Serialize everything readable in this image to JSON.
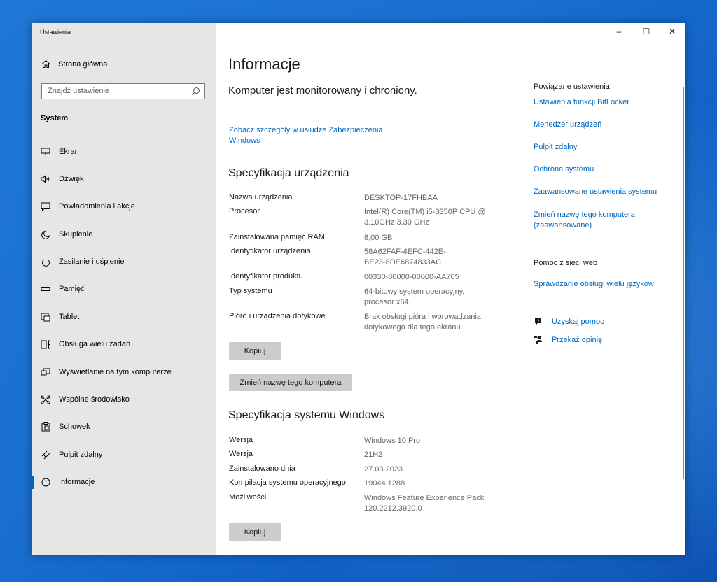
{
  "window": {
    "title": "Ustawienia",
    "controls": {
      "minimize": "–",
      "maximize": "☐",
      "close": "✕"
    }
  },
  "sidebar": {
    "home": "Strona główna",
    "search_placeholder": "Znajdź ustawienie",
    "section": "System",
    "items": [
      {
        "label": "Ekran",
        "icon": "monitor-icon"
      },
      {
        "label": "Dźwięk",
        "icon": "speaker-icon"
      },
      {
        "label": "Powiadomienia i akcje",
        "icon": "notification-icon"
      },
      {
        "label": "Skupienie",
        "icon": "moon-icon"
      },
      {
        "label": "Zasilanie i uśpienie",
        "icon": "power-icon"
      },
      {
        "label": "Pamięć",
        "icon": "storage-icon"
      },
      {
        "label": "Tablet",
        "icon": "tablet-icon"
      },
      {
        "label": "Obsługa wielu zadań",
        "icon": "multitasking-icon"
      },
      {
        "label": "Wyświetlanie na tym komputerze",
        "icon": "projecting-icon"
      },
      {
        "label": "Wspólne środowisko",
        "icon": "shared-icon"
      },
      {
        "label": "Schowek",
        "icon": "clipboard-icon"
      },
      {
        "label": "Pulpit zdalny",
        "icon": "remote-icon"
      },
      {
        "label": "Informacje",
        "icon": "info-icon",
        "active": true
      }
    ]
  },
  "main": {
    "title": "Informacje",
    "status": "Komputer jest monitorowany i chroniony.",
    "security_link": "Zobacz szczegóły w usłudze Zabezpieczenia Windows",
    "device_heading": "Specyfikacja urządzenia",
    "device_specs": [
      {
        "label": "Nazwa urządzenia",
        "value": "DESKTOP-17FHBAA"
      },
      {
        "label": "Procesor",
        "value": "Intel(R) Core(TM) i5-3350P CPU @ 3.10GHz   3.30 GHz"
      },
      {
        "label": "Zainstalowana pamięć RAM",
        "value": "8,00 GB"
      },
      {
        "label": "Identyfikator urządzenia",
        "value": "58A62FAF-4EFC-442E-BE23-8DE6874833AC"
      },
      {
        "label": "Identyfikator produktu",
        "value": "00330-80000-00000-AA705"
      },
      {
        "label": "Typ systemu",
        "value": "64-bitowy system operacyjny, procesor x64"
      },
      {
        "label": "Pióro i urządzenia dotykowe",
        "value": "Brak obsługi pióra i wprowadzania dotykowego dla tego ekranu"
      }
    ],
    "copy_button": "Kopiuj",
    "rename_button": "Zmień nazwę tego komputera",
    "windows_heading": "Specyfikacja systemu Windows",
    "windows_specs": [
      {
        "label": "Wersja",
        "value": "Windows 10 Pro"
      },
      {
        "label": "Wersja",
        "value": "21H2"
      },
      {
        "label": "Zainstalowano dnia",
        "value": "27.03.2023"
      },
      {
        "label": "Kompilacja systemu operacyjnego",
        "value": "19044.1288"
      },
      {
        "label": "Możliwości",
        "value": "Windows Feature Experience Pack 120.2212.3920.0"
      }
    ],
    "copy_button_2": "Kopiuj"
  },
  "related": {
    "title": "Powiązane ustawienia",
    "links": [
      "Ustawienia funkcji BitLocker",
      "Menedżer urządzeń",
      "Pulpit zdalny",
      "Ochrona systemu",
      "Zaawansowane ustawienia systemu",
      "Zmień nazwę tego komputera (zaawansowane)"
    ],
    "web_help_title": "Pomoc z sieci web",
    "web_help_link": "Sprawdzanie obsługi wielu języków",
    "get_help": "Uzyskaj pomoc",
    "feedback": "Przekaż opinię"
  }
}
